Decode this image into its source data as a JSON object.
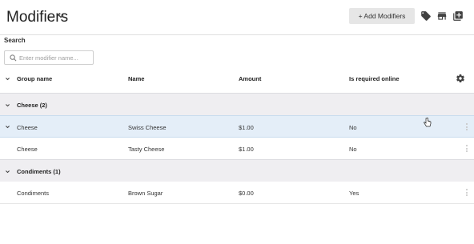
{
  "header": {
    "title": "Modifiers",
    "add_button_label": "+ Add Modifiers",
    "icons": [
      "tag-icon",
      "store-icon",
      "add-box-icon"
    ]
  },
  "search": {
    "label": "Search",
    "placeholder": "Enter modifier name...",
    "value": ""
  },
  "table": {
    "columns": {
      "group_name": "Group name",
      "name": "Name",
      "amount": "Amount",
      "required_online": "Is required online"
    },
    "groups": [
      {
        "title": "Cheese (2)",
        "rows": [
          {
            "group": "Cheese",
            "name": "Swiss Cheese",
            "amount": "$1.00",
            "required": "No"
          },
          {
            "group": "Cheese",
            "name": "Tasty Cheese",
            "amount": "$1.00",
            "required": "No"
          }
        ]
      },
      {
        "title": "Condiments (1)",
        "rows": [
          {
            "group": "Condiments",
            "name": "Brown Sugar",
            "amount": "$0.00",
            "required": "Yes"
          }
        ]
      }
    ]
  },
  "colors": {
    "selected_row": "#e4eef8",
    "group_row": "#efeef1",
    "icon": "#424242"
  }
}
